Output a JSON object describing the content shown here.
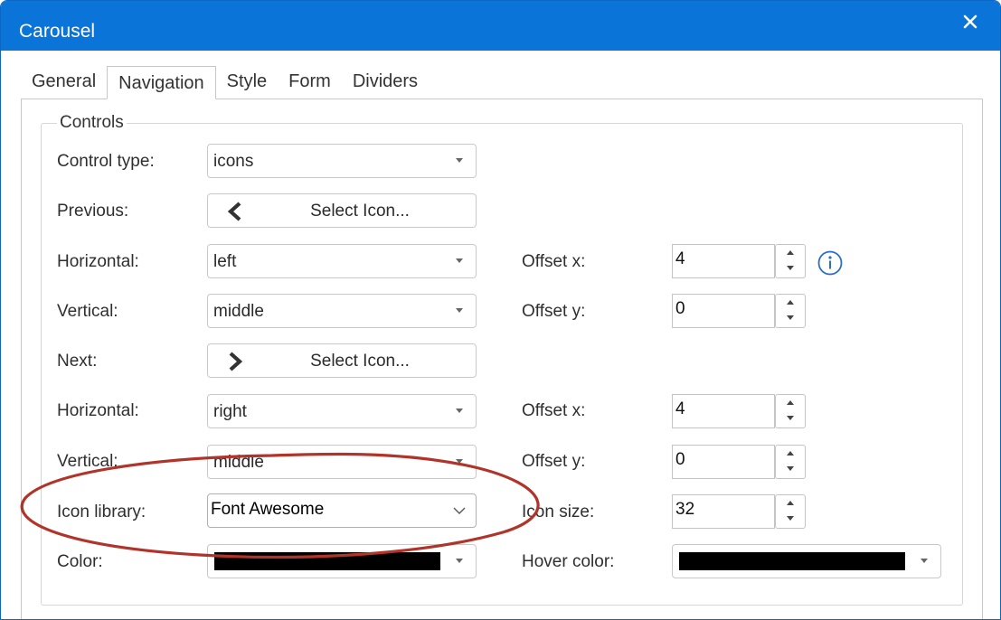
{
  "window": {
    "title": "Carousel"
  },
  "tabs": [
    {
      "label": "General"
    },
    {
      "label": "Navigation"
    },
    {
      "label": "Style"
    },
    {
      "label": "Form"
    },
    {
      "label": "Dividers"
    }
  ],
  "controls": {
    "legend": "Controls",
    "control_type": {
      "label": "Control type:",
      "value": "icons"
    },
    "previous": {
      "label": "Previous:",
      "button_label": "Select Icon...",
      "icon": "chevron-left-icon"
    },
    "prev_horizontal": {
      "label": "Horizontal:",
      "value": "left"
    },
    "prev_vertical": {
      "label": "Vertical:",
      "value": "middle"
    },
    "prev_offset_x": {
      "label": "Offset x:",
      "value": "4"
    },
    "prev_offset_y": {
      "label": "Offset y:",
      "value": "0"
    },
    "next": {
      "label": "Next:",
      "button_label": "Select Icon...",
      "icon": "chevron-right-icon"
    },
    "next_horizontal": {
      "label": "Horizontal:",
      "value": "right"
    },
    "next_vertical": {
      "label": "Vertical:",
      "value": "middle"
    },
    "next_offset_x": {
      "label": "Offset x:",
      "value": "4"
    },
    "next_offset_y": {
      "label": "Offset y:",
      "value": "0"
    },
    "icon_library": {
      "label": "Icon library:",
      "value": "Font Awesome"
    },
    "icon_size": {
      "label": "Icon size:",
      "value": "32"
    },
    "color": {
      "label": "Color:",
      "value": "#000000"
    },
    "hover_color": {
      "label": "Hover color:",
      "value": "#000000"
    }
  },
  "colors": {
    "titlebar": "#0a74d8",
    "annotation_ring": "#b0342a",
    "info_icon": "#2a6fc2"
  }
}
